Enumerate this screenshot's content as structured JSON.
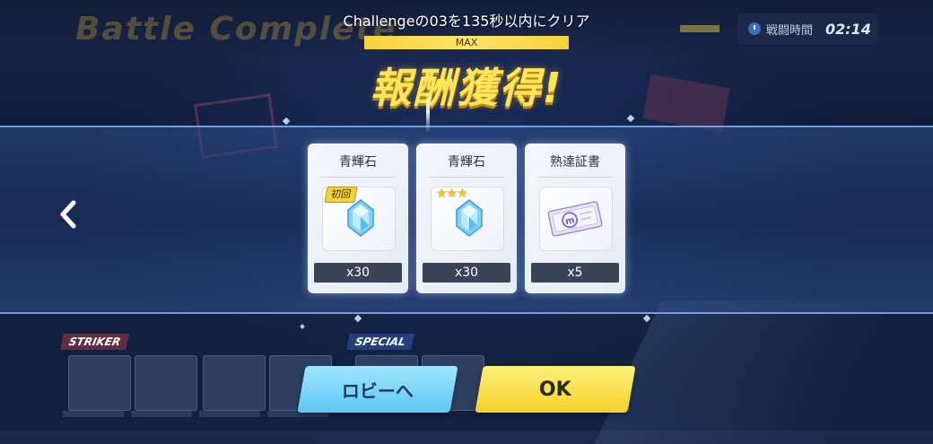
{
  "background": {
    "title": "Battle Complete"
  },
  "timer": {
    "label": "戦闘時間",
    "value": "02:14",
    "icon": "clock-icon"
  },
  "challenge": {
    "text": "Challengeの03を135秒以内にクリア",
    "progress_label": "MAX",
    "progress": 1.0
  },
  "headline": "報酬獲得!",
  "rewards": [
    {
      "name": "青輝石",
      "quantity": "x30",
      "badge": "初回",
      "icon": "blue-gem-icon"
    },
    {
      "name": "青輝石",
      "quantity": "x30",
      "star_rating": 3,
      "icon": "blue-gem-icon"
    },
    {
      "name": "熟達証書",
      "quantity": "x5",
      "icon": "mastery-certificate-icon"
    }
  ],
  "team": {
    "striker_label": "STRIKER",
    "special_label": "SPECIAL"
  },
  "buttons": {
    "lobby": "ロビーへ",
    "ok": "OK"
  },
  "colors": {
    "accent_yellow": "#f5d22c",
    "accent_blue": "#5fc6f4",
    "banner_edge": "#8cbeff"
  }
}
